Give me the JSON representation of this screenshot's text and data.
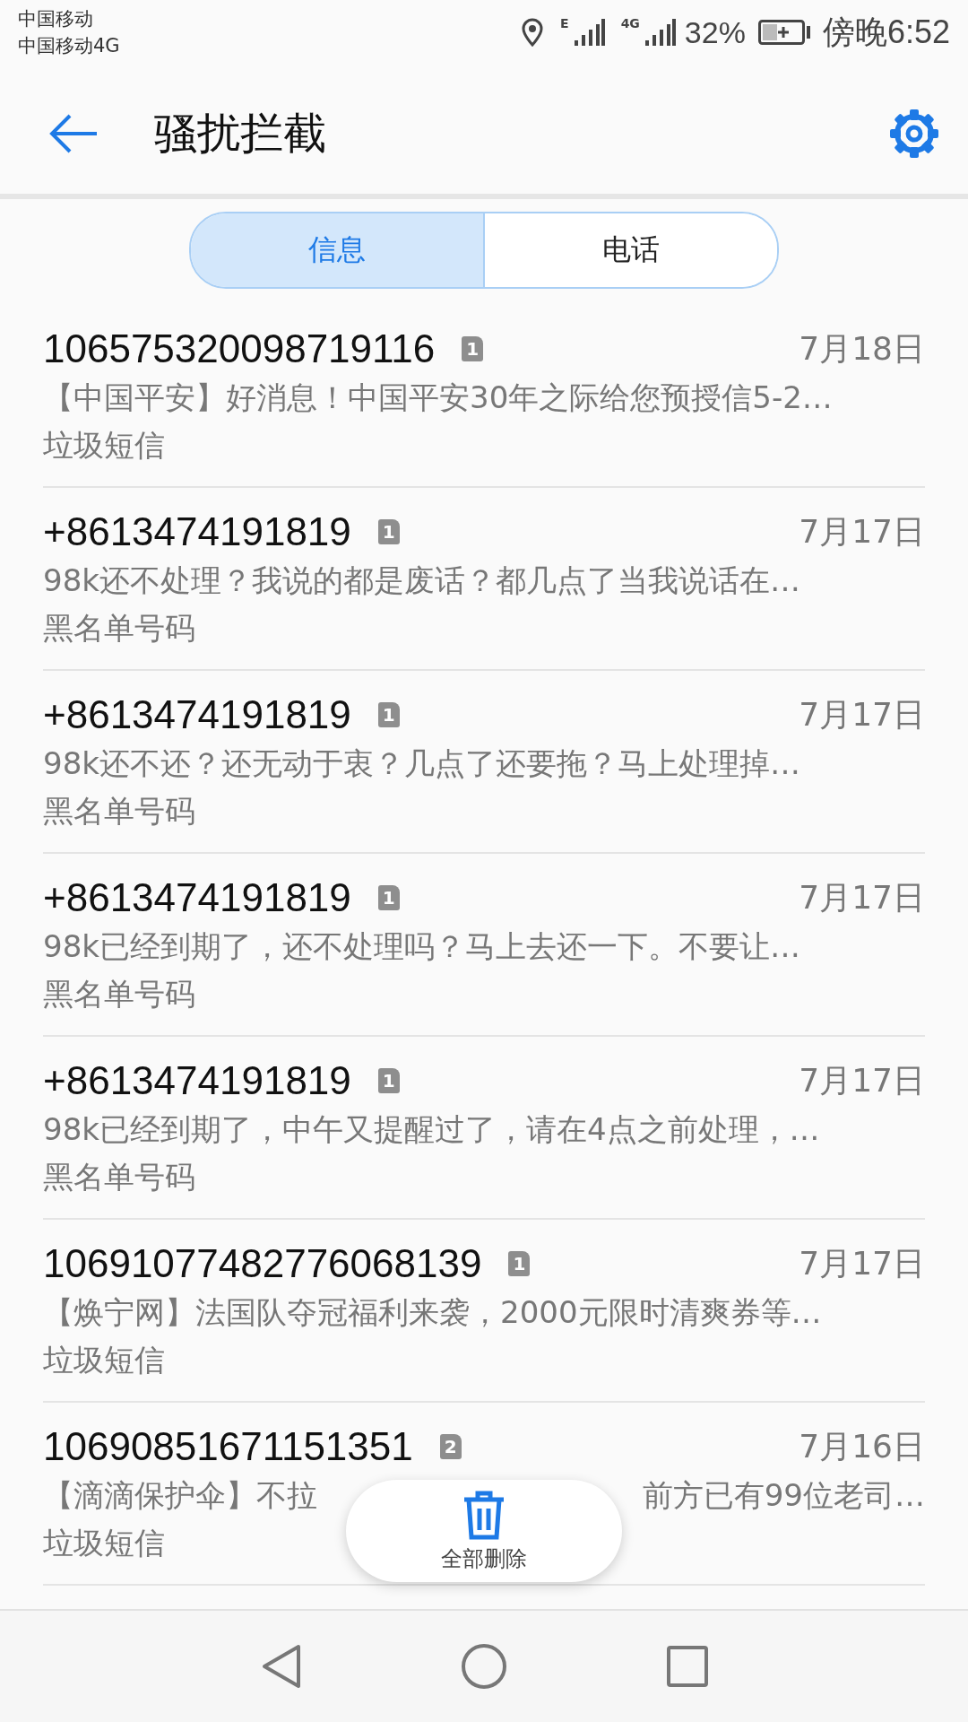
{
  "status_bar": {
    "carriers": [
      "中国移动",
      "中国移动4G"
    ],
    "sim1_network": "E",
    "sim2_network": "4G",
    "battery": "32%",
    "time": "傍晚6:52"
  },
  "app_bar": {
    "title": "骚扰拦截"
  },
  "tabs": [
    {
      "label": "信息",
      "selected": true
    },
    {
      "label": "电话",
      "selected": false
    }
  ],
  "messages": [
    {
      "sender": "106575320098719116",
      "sim": "1",
      "date": "7月18日",
      "preview": "【中国平安】好消息！中国平安30年之际给您预授信5-2…",
      "tag": "垃圾短信"
    },
    {
      "sender": "+8613474191819",
      "sim": "1",
      "date": "7月17日",
      "preview": "98k还不处理？我说的都是废话？都几点了当我说话在…",
      "tag": "黑名单号码"
    },
    {
      "sender": "+8613474191819",
      "sim": "1",
      "date": "7月17日",
      "preview": "98k还不还？还无动于衷？几点了还要拖？马上处理掉…",
      "tag": "黑名单号码"
    },
    {
      "sender": "+8613474191819",
      "sim": "1",
      "date": "7月17日",
      "preview": "98k已经到期了，还不处理吗？马上去还一下。不要让…",
      "tag": "黑名单号码"
    },
    {
      "sender": "+8613474191819",
      "sim": "1",
      "date": "7月17日",
      "preview": "98k已经到期了，中午又提醒过了，请在4点之前处理，…",
      "tag": "黑名单号码"
    },
    {
      "sender": "10691077482776068139",
      "sim": "1",
      "date": "7月17日",
      "preview": "【焕宁网】法国队夺冠福利来袭，2000元限时清爽券等…",
      "tag": "垃圾短信"
    },
    {
      "sender": "10690851671151351",
      "sim": "2",
      "date": "7月16日",
      "preview": "【滴滴保护伞】不拉",
      "preview_end": "前方已有99位老司…",
      "tag": "垃圾短信"
    }
  ],
  "delete_all": {
    "label": "全部删除"
  }
}
